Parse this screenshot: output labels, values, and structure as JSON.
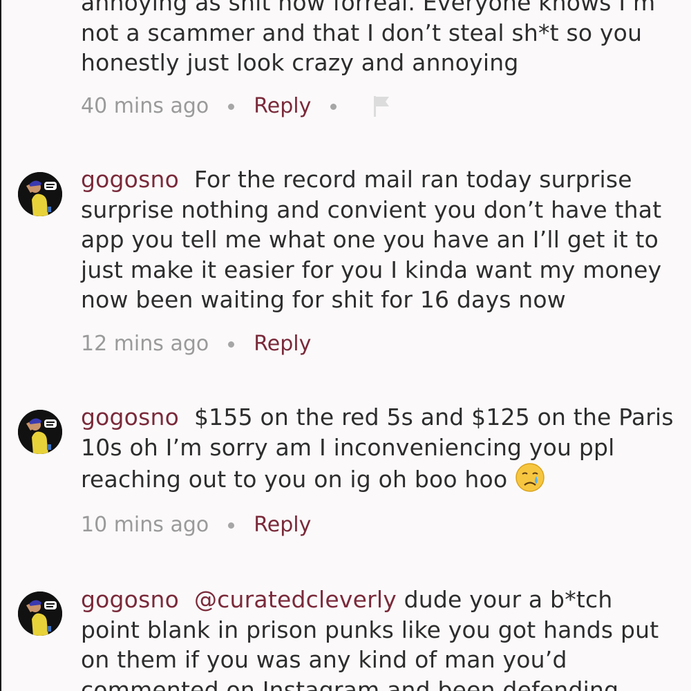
{
  "comments": [
    {
      "text": "annoying as shit now forreal. Everyone knows I’m not a scammer and that I don’t steal sh*t so you honestly just look crazy and annoying",
      "time": "40 mins ago",
      "reply": "Reply",
      "flag_icon": "flag-icon"
    },
    {
      "user": "gogosno",
      "text": "For the record mail ran today surprise surprise nothing and convient you don’t have that app you tell me what one you have an I’ll get it to just make it easier for you I kinda want my money now been waiting for shit for 16 days now",
      "time": "12 mins ago",
      "reply": "Reply"
    },
    {
      "user": "gogosno",
      "text": "$155 on the red 5s and $125 on the Paris 10s oh I’m sorry am I inconveniencing you ppl reaching out to you on ig oh boo hoo",
      "emoji": "crying-face-emoji",
      "time": "10 mins ago",
      "reply": "Reply"
    },
    {
      "user": "gogosno",
      "mention": "@curatedcleverly",
      "text": "dude your a b*tch point blank in prison punks like you got hands put on them if you was any kind of man you’d commented on Instagram and been defending"
    }
  ],
  "colors": {
    "background": "#fbf9fa",
    "username": "#7a2a3a",
    "reply": "#7a2a3a",
    "timestamp": "#9a9a9a",
    "body_text": "#2d2d2d"
  }
}
